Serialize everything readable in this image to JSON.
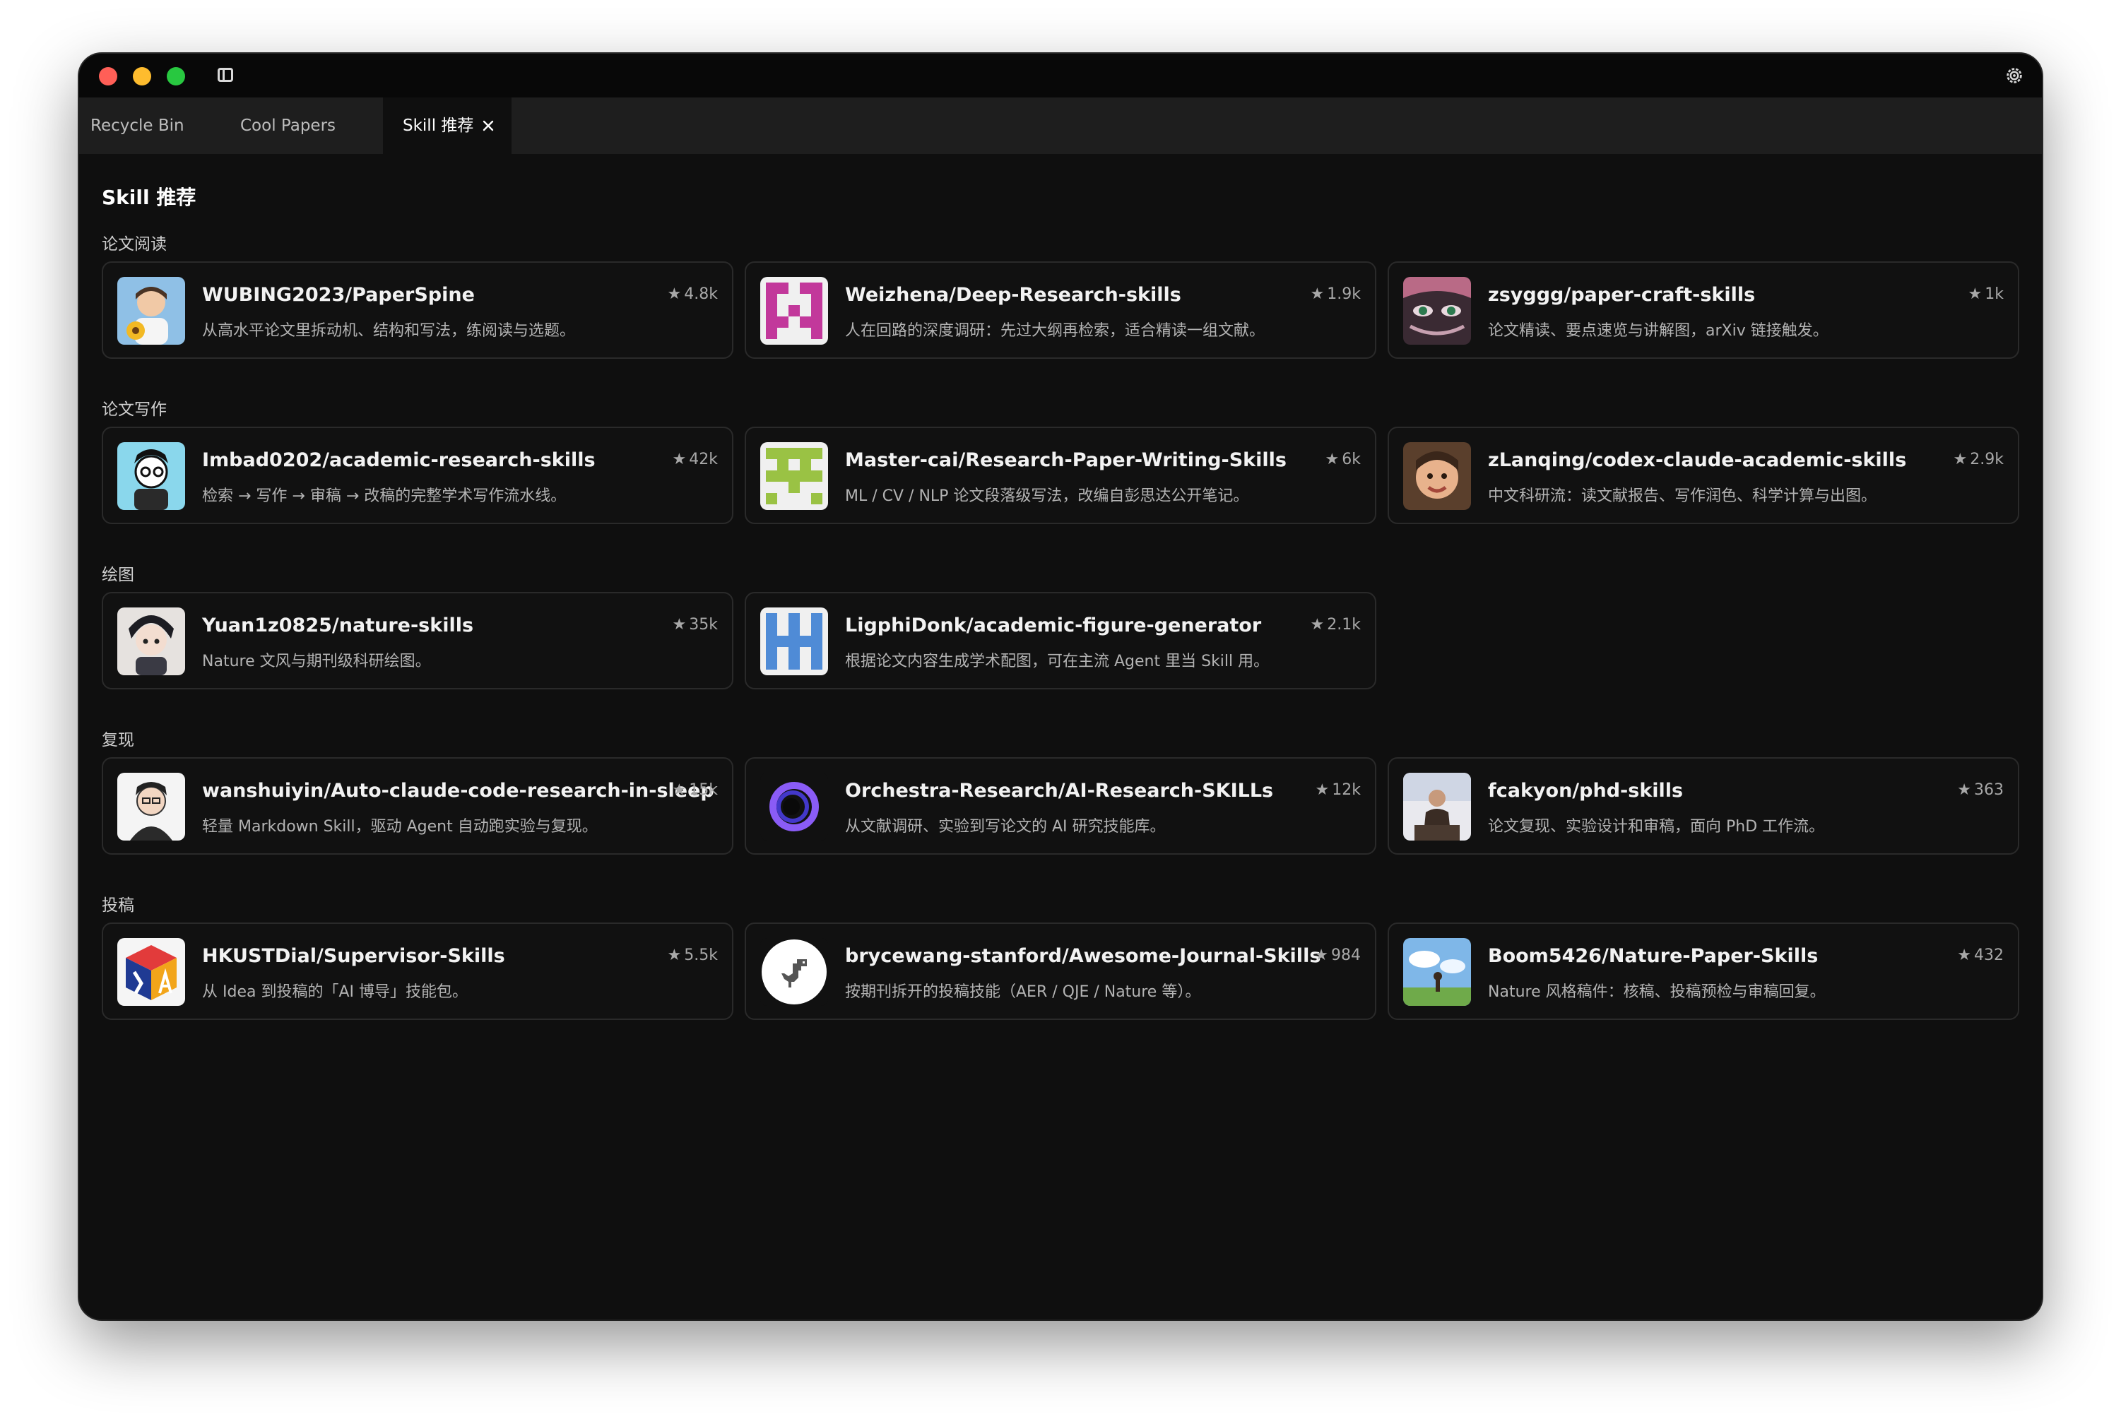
{
  "tabs": [
    {
      "label": "Recycle Bin"
    },
    {
      "label": "Cool Papers"
    },
    {
      "label": "Skill 推荐",
      "active": true
    }
  ],
  "page_title": "Skill 推荐",
  "sections": [
    {
      "title": "论文阅读",
      "cards": [
        {
          "name": "WUBING2023/PaperSpine",
          "desc": "从高水平论文里拆动机、结构和写法，练阅读与选题。",
          "stars": "4.8k",
          "avatar_icon": "portrait-sunflower-avatar"
        },
        {
          "name": "Weizhena/Deep-Research-skills",
          "desc": "人在回路的深度调研：先过大纲再检索，适合精读一组文献。",
          "stars": "1.9k",
          "avatar_icon": "identicon-magenta-avatar"
        },
        {
          "name": "zsyggg/paper-craft-skills",
          "desc": "论文精读、要点速览与讲解图，arXiv 链接触发。",
          "stars": "1k",
          "avatar_icon": "anime-eyes-avatar"
        }
      ]
    },
    {
      "title": "论文写作",
      "cards": [
        {
          "name": "Imbad0202/academic-research-skills",
          "desc": "检索 → 写作 → 审稿 → 改稿的完整学术写作流水线。",
          "stars": "42k",
          "avatar_icon": "cartoon-scholar-avatar"
        },
        {
          "name": "Master-cai/Research-Paper-Writing-Skills",
          "desc": "ML / CV / NLP 论文段落级写法，改编自彭思达公开笔记。",
          "stars": "6k",
          "avatar_icon": "identicon-green-avatar"
        },
        {
          "name": "zLanqing/codex-claude-academic-skills",
          "desc": "中文科研流：读文献报告、写作润色、科学计算与出图。",
          "stars": "2.9k",
          "avatar_icon": "child-photo-avatar"
        }
      ]
    },
    {
      "title": "绘图",
      "cards": [
        {
          "name": "Yuan1z0825/nature-skills",
          "desc": "Nature 文风与期刊级科研绘图。",
          "stars": "35k",
          "avatar_icon": "anime-boy-avatar"
        },
        {
          "name": "LigphiDonk/academic-figure-generator",
          "desc": "根据论文内容生成学术配图，可在主流 Agent 里当 Skill 用。",
          "stars": "2.1k",
          "avatar_icon": "identicon-blue-avatar"
        }
      ]
    },
    {
      "title": "复现",
      "cards": [
        {
          "name": "wanshuiyin/Auto-claude-code-research-in-sleep",
          "desc": "轻量 Markdown Skill，驱动 Agent 自动跑实验与复现。",
          "stars": "15k",
          "avatar_icon": "sketch-portrait-avatar"
        },
        {
          "name": "Orchestra-Research/AI-Research-SKILLs",
          "desc": "从文献调研、实验到写论文的 AI 研究技能库。",
          "stars": "12k",
          "avatar_icon": "purple-ring-avatar"
        },
        {
          "name": "fcakyon/phd-skills",
          "desc": "论文复现、实验设计和审稿，面向 PhD 工作流。",
          "stars": "363",
          "avatar_icon": "speaker-photo-avatar"
        }
      ]
    },
    {
      "title": "投稿",
      "cards": [
        {
          "name": "HKUSTDial/Supervisor-Skills",
          "desc": "从 Idea 到投稿的「AI 博导」技能包。",
          "stars": "5.5k",
          "avatar_icon": "colorful-cube-avatar"
        },
        {
          "name": "brycewang-stanford/Awesome-Journal-Skills",
          "desc": "按期刊拆开的投稿技能（AER / QJE / Nature 等）。",
          "stars": "984",
          "avatar_icon": "dinosaur-avatar"
        },
        {
          "name": "Boom5426/Nature-Paper-Skills",
          "desc": "Nature 风格稿件：核稿、投稿预检与审稿回复。",
          "stars": "432",
          "avatar_icon": "sky-landscape-avatar"
        }
      ]
    }
  ]
}
